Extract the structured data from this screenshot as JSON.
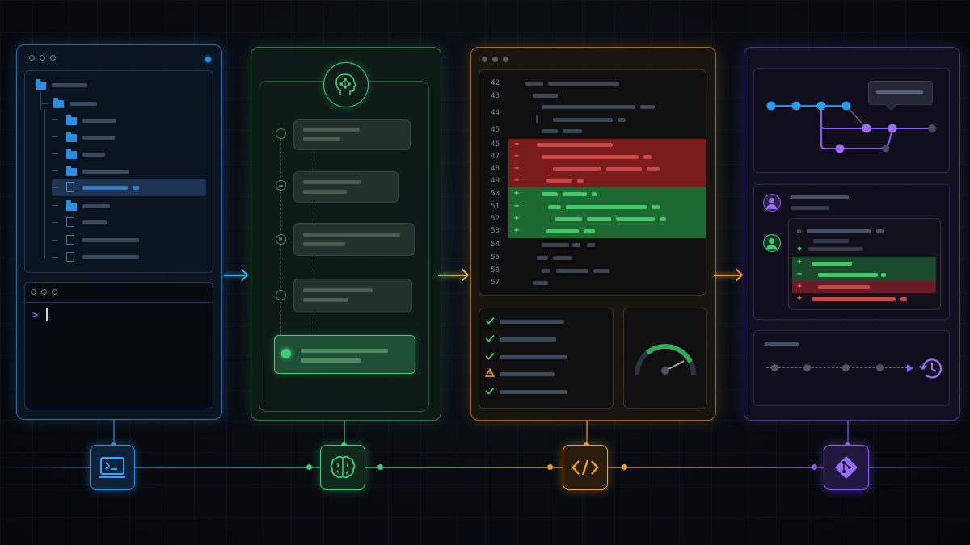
{
  "code_editor": {
    "line_numbers": [
      "42",
      "43",
      "44",
      "45",
      "46",
      "47",
      "48",
      "49",
      "50",
      "51",
      "52",
      "53",
      "54",
      "55",
      "56",
      "57"
    ],
    "markers": [
      {
        "line": "46",
        "sign": "−",
        "type": "removed"
      },
      {
        "line": "47",
        "sign": "−",
        "type": "removed"
      },
      {
        "line": "48",
        "sign": "−",
        "type": "removed"
      },
      {
        "line": "49",
        "sign": "−",
        "type": "removed"
      },
      {
        "line": "50",
        "sign": "+",
        "type": "added"
      },
      {
        "line": "51",
        "sign": "−",
        "type": "added"
      },
      {
        "line": "52",
        "sign": "+",
        "type": "added"
      },
      {
        "line": "53",
        "sign": "+",
        "type": "added"
      }
    ]
  },
  "terminal": {
    "prompt": ">"
  },
  "quality_gauge": {
    "level": 0.85
  },
  "review": {
    "diff_markers": [
      {
        "sign": "+",
        "type": "added"
      },
      {
        "sign": "−",
        "type": "added"
      },
      {
        "sign": "+",
        "type": "removed"
      },
      {
        "sign": "+",
        "type": "removed"
      }
    ]
  },
  "icons": {
    "terminal": "terminal-icon",
    "ai": "brain-icon",
    "code": "code-icon",
    "git": "git-icon",
    "history": "history-icon"
  },
  "colors": {
    "blue": "#2b8fe0",
    "green": "#3ccf78",
    "orange": "#f0a030",
    "purple": "#8a5cf0",
    "removed_bg": "#7a1c1c",
    "added_bg": "#1c6a32"
  }
}
